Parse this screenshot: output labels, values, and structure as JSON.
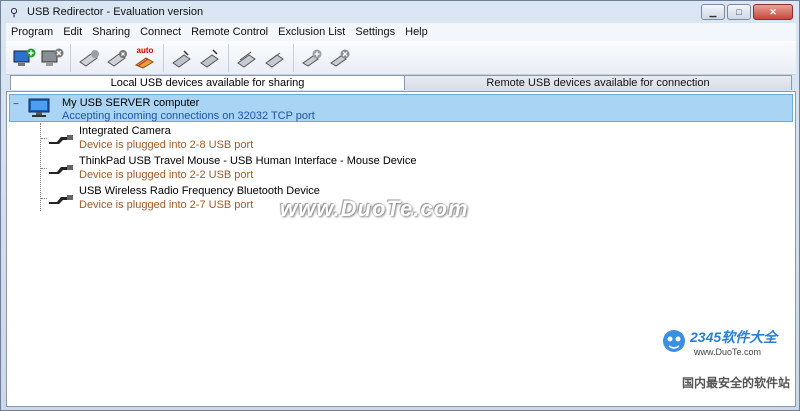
{
  "window": {
    "title": "USB Redirector - Evaluation version",
    "minimize": "▁",
    "maximize": "□",
    "close": "✕"
  },
  "menu": [
    "Program",
    "Edit",
    "Sharing",
    "Connect",
    "Remote Control",
    "Exclusion List",
    "Settings",
    "Help"
  ],
  "toolbar": {
    "auto_label": "auto",
    "icons": [
      "add-server-icon",
      "remove-server-icon",
      "share-device-icon",
      "unshare-device-icon",
      "auto-share-icon",
      "connect-icon",
      "disconnect-icon",
      "connect-all-icon",
      "disconnect-all-icon",
      "add-remote-icon",
      "remove-remote-icon"
    ]
  },
  "tabs": {
    "local": "Local USB devices available for sharing",
    "remote": "Remote USB devices available for connection"
  },
  "server": {
    "name": "My USB SERVER computer",
    "status": "Accepting incoming connections on 32032 TCP port",
    "collapse_symbol": "−"
  },
  "devices": [
    {
      "name": "Integrated Camera",
      "status": "Device is plugged into 2-8 USB port"
    },
    {
      "name": "ThinkPad USB Travel Mouse - USB Human Interface - Mouse Device",
      "status": "Device is plugged into 2-2 USB port"
    },
    {
      "name": "USB Wireless Radio Frequency Bluetooth Device",
      "status": "Device is plugged into 2-7 USB port"
    }
  ],
  "watermark": {
    "text": "www.DuoTe.com",
    "brand": "2345软件大全",
    "url": "www.DuoTe.com",
    "tagline": "国内最安全的软件站"
  },
  "colors": {
    "selection": "#aad4f4",
    "status_blue": "#1c55a6",
    "status_brown": "#a05a28"
  }
}
